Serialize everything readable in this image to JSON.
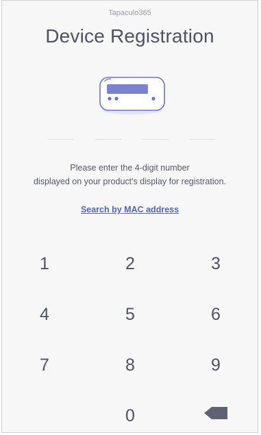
{
  "header": {
    "brand": "Tapaculo365",
    "title": "Device Registration"
  },
  "instructions": {
    "line1": "Please enter the 4-digit number",
    "line2": "displayed on your product's display for registration."
  },
  "links": {
    "search_mac": "Search by MAC address"
  },
  "code_input": {
    "digits_entered": 0,
    "slots": 4
  },
  "keypad": {
    "k1": "1",
    "k2": "2",
    "k3": "3",
    "k4": "4",
    "k5": "5",
    "k6": "6",
    "k7": "7",
    "k8": "8",
    "k9": "9",
    "k0": "0",
    "backspace_icon": "backspace-icon"
  },
  "colors": {
    "accent": "#5562c6",
    "text": "#4f5164",
    "background": "#f7f7f8",
    "device_outline": "#6b72c8"
  }
}
